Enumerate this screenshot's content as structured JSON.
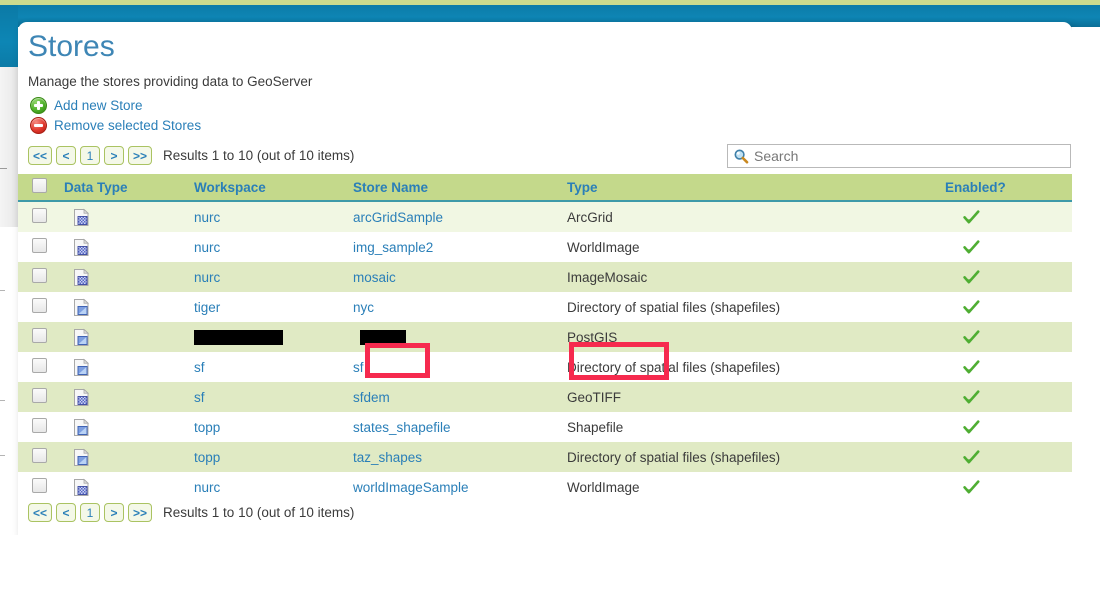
{
  "window": {
    "accent_blue": "#0e85b4",
    "top_strip_green": "#cbdb8e",
    "panel_bg": "#ffffff"
  },
  "page": {
    "title": "Stores",
    "subtitle": "Manage the stores providing data to GeoServer",
    "title_color": "#3e86b5",
    "link_color": "#2a7fb8"
  },
  "actions": [
    {
      "label": "Add new Store",
      "icon": "plus-circle-icon"
    },
    {
      "label": "Remove selected Stores",
      "icon": "minus-circle-icon"
    }
  ],
  "pager": {
    "first_label": "<<",
    "prev_label": "<",
    "page_label": "1",
    "next_label": ">",
    "last_label": ">>",
    "results_text": "Results 1 to 10 (out of 10 items)"
  },
  "search": {
    "placeholder": "Search",
    "value": "",
    "icon": "magnifier-icon"
  },
  "table": {
    "header_bg": "#c4d98b",
    "columns": [
      {
        "key": "check",
        "label": ""
      },
      {
        "key": "data_type",
        "label": "Data Type"
      },
      {
        "key": "workspace",
        "label": "Workspace"
      },
      {
        "key": "store_name",
        "label": "Store Name"
      },
      {
        "key": "type",
        "label": "Type"
      },
      {
        "key": "enabled",
        "label": "Enabled?"
      }
    ],
    "rows": [
      {
        "data_type_icon": "raster-store-icon",
        "workspace": "nurc",
        "store_name": "arcGridSample",
        "type": "ArcGrid",
        "enabled": true,
        "redacted": false
      },
      {
        "data_type_icon": "raster-store-icon",
        "workspace": "nurc",
        "store_name": "img_sample2",
        "type": "WorldImage",
        "enabled": true,
        "redacted": false
      },
      {
        "data_type_icon": "raster-store-icon",
        "workspace": "nurc",
        "store_name": "mosaic",
        "type": "ImageMosaic",
        "enabled": true,
        "redacted": false
      },
      {
        "data_type_icon": "vector-store-icon",
        "workspace": "tiger",
        "store_name": "nyc",
        "type": "Directory of spatial files (shapefiles)",
        "enabled": true,
        "redacted": false
      },
      {
        "data_type_icon": "vector-store-icon",
        "workspace": "",
        "store_name": "",
        "type": "PostGIS",
        "enabled": true,
        "redacted": true
      },
      {
        "data_type_icon": "vector-store-icon",
        "workspace": "sf",
        "store_name": "sf",
        "type": "Directory of spatial files (shapefiles)",
        "enabled": true,
        "redacted": false
      },
      {
        "data_type_icon": "raster-store-icon",
        "workspace": "sf",
        "store_name": "sfdem",
        "type": "GeoTIFF",
        "enabled": true,
        "redacted": false
      },
      {
        "data_type_icon": "vector-store-icon",
        "workspace": "topp",
        "store_name": "states_shapefile",
        "type": "Shapefile",
        "enabled": true,
        "redacted": false
      },
      {
        "data_type_icon": "vector-store-icon",
        "workspace": "topp",
        "store_name": "taz_shapes",
        "type": "Directory of spatial files (shapefiles)",
        "enabled": true,
        "redacted": false
      },
      {
        "data_type_icon": "raster-store-icon",
        "workspace": "nurc",
        "store_name": "worldImageSample",
        "type": "WorldImage",
        "enabled": true,
        "redacted": false
      }
    ]
  },
  "annotations": {
    "color": "#f62a4e",
    "boxes": [
      {
        "target": "store-name-cell-redacted"
      },
      {
        "target": "type-cell-postgis"
      }
    ]
  }
}
